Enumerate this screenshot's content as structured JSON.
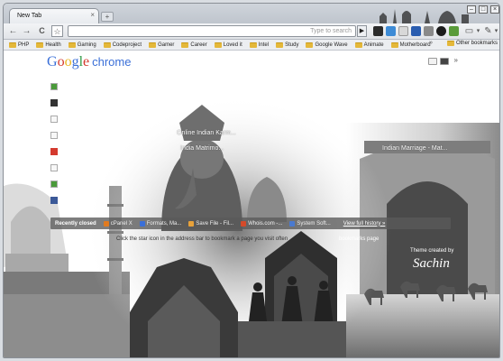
{
  "tab": {
    "title": "New Tab",
    "close": "×",
    "new_tab": "+"
  },
  "window_controls": [
    "–",
    "□",
    "×"
  ],
  "toolbar": {
    "back": "←",
    "forward": "→",
    "reload": "C",
    "star": "☆",
    "omnibox_placeholder": "Type to search",
    "go": "▶",
    "page_menu": "▾",
    "tools_menu": "▾"
  },
  "bookmarks": [
    {
      "label": "PHP"
    },
    {
      "label": "Health"
    },
    {
      "label": "Gaming"
    },
    {
      "label": "Codeproject"
    },
    {
      "label": "Gamer"
    },
    {
      "label": "Career"
    },
    {
      "label": "Loved it"
    },
    {
      "label": "Intel"
    },
    {
      "label": "Study"
    },
    {
      "label": "Google Wave"
    },
    {
      "label": "Animate"
    },
    {
      "label": "Motherboard"
    }
  ],
  "bookmarks_overflow": "»",
  "other_bookmarks": "Other bookmarks",
  "logo": {
    "letters": [
      "G",
      "o",
      "o",
      "g",
      "l",
      "e"
    ],
    "product": "chrome"
  },
  "view_more": "»",
  "tiles": [
    {
      "label": "Online Indian Karm..."
    },
    {
      "label": "India Matrimo..."
    },
    {
      "label": "Indian Marriage - Mat..."
    }
  ],
  "recently_closed": {
    "title": "Recently closed",
    "items": [
      {
        "label": "cPanel X",
        "color": "#e07a1f"
      },
      {
        "label": "Formats, Ma...",
        "color": "#3a6fd8"
      },
      {
        "label": "Save File - Fil...",
        "color": "#e8a23a"
      },
      {
        "label": "Whois.com -...",
        "color": "#d44a2a"
      },
      {
        "label": "System Soft...",
        "color": "#4a7ad0"
      }
    ],
    "view_full": "View full history »"
  },
  "hint": "Click the star icon in the address bar to bookmark a page you visit often",
  "hint_right": "bookmarks page",
  "theme_credit": {
    "label": "Theme created by",
    "name": "Sachin"
  }
}
